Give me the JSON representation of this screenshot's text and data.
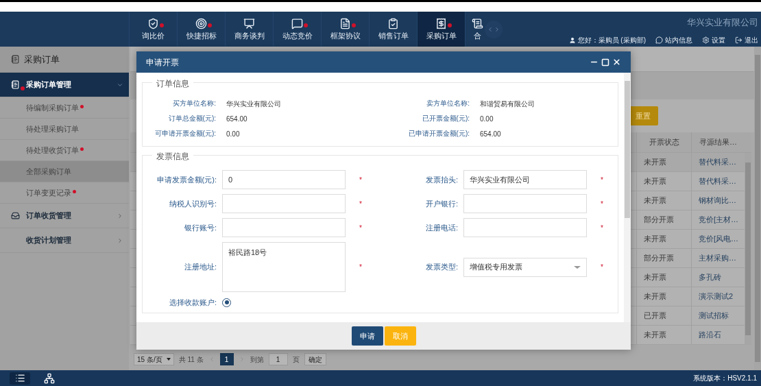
{
  "header": {
    "nav": [
      {
        "label": "询比价",
        "dot": true,
        "selected": false
      },
      {
        "label": "快捷招标",
        "dot": true,
        "selected": false
      },
      {
        "label": "商务谈判",
        "dot": false,
        "selected": false
      },
      {
        "label": "动态竞价",
        "dot": true,
        "selected": false
      },
      {
        "label": "框架协议",
        "dot": true,
        "selected": false
      },
      {
        "label": "销售订单",
        "dot": false,
        "selected": false
      },
      {
        "label": "采购订单",
        "dot": true,
        "selected": true
      },
      {
        "label": "合",
        "dot": false,
        "selected": false
      }
    ],
    "company": "华兴实业有限公司",
    "user": "您好：采购员 (采购部)",
    "links": [
      "站内信息",
      "设置",
      "退出"
    ]
  },
  "sidebar": {
    "title": "采购订单",
    "groups": [
      {
        "label": "采购订单管理",
        "dot": true,
        "expanded": true,
        "children": [
          {
            "label": "待编制采购订单",
            "dot": true,
            "selected": false
          },
          {
            "label": "待处理采购订单",
            "dot": false,
            "selected": false
          },
          {
            "label": "待处理收货订单",
            "dot": true,
            "selected": false
          },
          {
            "label": "全部采购订单",
            "dot": false,
            "selected": true
          },
          {
            "label": "订单变更记录",
            "dot": true,
            "selected": false
          }
        ]
      },
      {
        "label": "订单收货管理",
        "dot": false,
        "expanded": false
      },
      {
        "label": "收货计划管理",
        "dot": false,
        "expanded": false
      }
    ]
  },
  "main": {
    "reset_button": "重置",
    "table": {
      "columns": [
        "开票状态",
        "寻源结果…"
      ],
      "rows": [
        [
          "未开票",
          "替代料采…"
        ],
        [
          "未开票",
          "替代料采…"
        ],
        [
          "未开票",
          "钢材询比…"
        ],
        [
          "部分开票",
          "竞价[主材…"
        ],
        [
          "未开票",
          "竞价[风电…"
        ],
        [
          "部分开票",
          "主材采购…"
        ],
        [
          "未开票",
          "多孔砖"
        ],
        [
          "未开票",
          "演示测试2"
        ],
        [
          "已开票",
          "测试招标"
        ],
        [
          "未开票",
          "路沿石"
        ]
      ]
    },
    "pagination": {
      "page_size": "15 条/页",
      "total": "共 11 条",
      "current": "1",
      "goto_label": "到第",
      "goto_value": "1",
      "page_unit": "页",
      "confirm": "确定"
    }
  },
  "dialog": {
    "title": "申请开票",
    "order_section": {
      "legend": "订单信息",
      "rows": [
        [
          {
            "label": "买方单位名称:",
            "value": "华兴实业有限公司"
          },
          {
            "label": "卖方单位名称:",
            "value": "和谐贸易有限公司"
          }
        ],
        [
          {
            "label": "订单总金额(元):",
            "value": "654.00"
          },
          {
            "label": "已开票金额(元):",
            "value": "0.00"
          }
        ],
        [
          {
            "label": "可申请开票金额(元):",
            "value": "0.00"
          },
          {
            "label": "已申请开票金额(元):",
            "value": "654.00"
          }
        ]
      ]
    },
    "invoice_section": {
      "legend": "发票信息",
      "rows": [
        [
          {
            "kind": "input",
            "label": "申请发票金额(元):",
            "value": "0",
            "required": "*"
          },
          {
            "kind": "input",
            "label": "发票抬头:",
            "value": "华兴实业有限公司",
            "required": "*"
          }
        ],
        [
          {
            "kind": "input",
            "label": "纳税人识别号:",
            "required": "*"
          },
          {
            "kind": "input",
            "label": "开户银行:",
            "required": "*"
          }
        ],
        [
          {
            "kind": "input",
            "label": "银行账号:",
            "required": "*"
          },
          {
            "kind": "input",
            "label": "注册电话:",
            "required": "*"
          }
        ],
        [
          {
            "kind": "textarea",
            "label": "注册地址:",
            "value": "裕民路18号",
            "required": "*"
          },
          {
            "kind": "select",
            "label": "发票类型:",
            "value": "增值税专用发票",
            "required": "*"
          }
        ]
      ],
      "account": {
        "label": "选择收款账户:",
        "checked": true
      }
    },
    "buttons": [
      {
        "label": "申请",
        "kind": "primary"
      },
      {
        "label": "取消",
        "kind": "warning"
      }
    ]
  },
  "footer": {
    "version": "系统版本：HSV2.1.1"
  }
}
